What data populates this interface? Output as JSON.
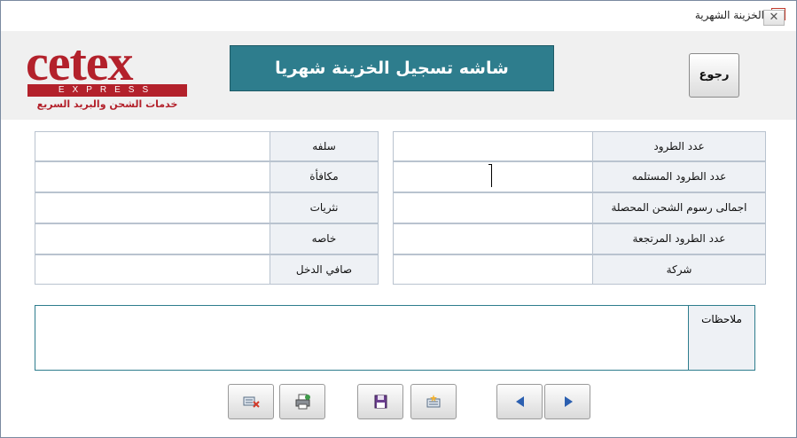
{
  "window": {
    "title": "الخزينة الشهرية",
    "close_glyph": "✕"
  },
  "logo": {
    "brand": "cetex",
    "tagline": "EXPRESS",
    "arabic": "خدمات الشحن والبريد السريع"
  },
  "banner": {
    "title": "شاشه تسجيل الخزينة شهريا"
  },
  "back_button": {
    "label": "رجوع"
  },
  "right_fields": [
    {
      "label": "عدد الطرود",
      "value": ""
    },
    {
      "label": "عدد الطرود المستلمه",
      "value": ""
    },
    {
      "label": "اجمالى رسوم الشحن المحصلة",
      "value": ""
    },
    {
      "label": "عدد الطرود المرتجعة",
      "value": ""
    },
    {
      "label": "شركة",
      "value": ""
    }
  ],
  "left_fields": [
    {
      "label": "سلفه",
      "value": ""
    },
    {
      "label": "مكافأة",
      "value": ""
    },
    {
      "label": "نثريات",
      "value": ""
    },
    {
      "label": "خاصه",
      "value": ""
    },
    {
      "label": "صافي الدخل",
      "value": ""
    }
  ],
  "notes": {
    "label": "ملاحظات",
    "value": ""
  },
  "buttons": [
    {
      "name": "delete-record-button",
      "icon": "delete-record-icon"
    },
    {
      "name": "print-button",
      "icon": "printer-icon"
    },
    {
      "name": "save-button",
      "icon": "save-icon"
    },
    {
      "name": "new-record-button",
      "icon": "new-record-icon"
    },
    {
      "name": "previous-record-button",
      "icon": "arrow-left-icon"
    },
    {
      "name": "next-record-button",
      "icon": "arrow-right-icon"
    }
  ],
  "colors": {
    "accent": "#2e7d8d",
    "brand_red": "#b3212b",
    "header_bg": "#f0f0f0"
  }
}
